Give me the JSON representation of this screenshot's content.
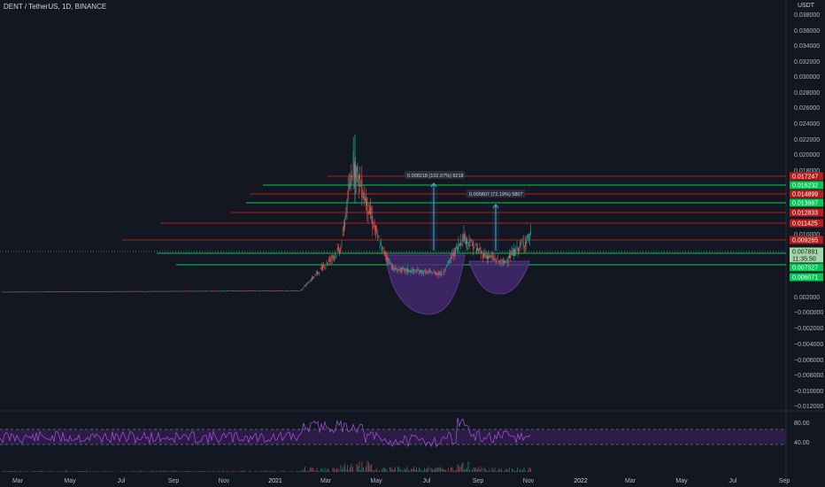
{
  "header": {
    "symbol": "DENT / TetherUS, 1D, BINANCE",
    "currency": "USDT"
  },
  "chart_data": {
    "type": "candlestick",
    "price_axis": {
      "ticks": [
        "0.038000",
        "0.036000",
        "0.034000",
        "0.032000",
        "0.030000",
        "0.028000",
        "0.026000",
        "0.024000",
        "0.022000",
        "0.020000",
        "0.018000",
        "0.010000",
        "0.002000",
        "−0.000000",
        "−0.002000",
        "−0.004000",
        "−0.006000",
        "−0.008000",
        "−0.010000",
        "−0.012000"
      ]
    },
    "time_axis": {
      "labels": [
        "Mar",
        "May",
        "Jul",
        "Sep",
        "Nov",
        "2021",
        "Mar",
        "May",
        "Jul",
        "Sep",
        "Nov",
        "2022",
        "Mar",
        "May",
        "Jul",
        "Sep"
      ]
    },
    "price_badges": [
      {
        "value": "0.017247",
        "color": "#b71c1c"
      },
      {
        "value": "0.016232",
        "color": "#00c853"
      },
      {
        "value": "0.014899",
        "color": "#b71c1c"
      },
      {
        "value": "0.013887",
        "color": "#00c853"
      },
      {
        "value": "0.012833",
        "color": "#b71c1c"
      },
      {
        "value": "0.011425",
        "color": "#b71c1c"
      },
      {
        "value": "0.009265",
        "color": "#b71c1c"
      },
      {
        "value": "0.007891",
        "color": "#a5d6a7"
      },
      {
        "value": "11:35:50",
        "color": "#a5d6a7"
      },
      {
        "value": "0.007527",
        "color": "#00c853"
      },
      {
        "value": "0.006071",
        "color": "#00c853"
      }
    ],
    "measure_labels": [
      {
        "text": "0.008218 (102.07%) 8218"
      },
      {
        "text": "0.005807 (72.19%) 5807"
      }
    ],
    "rsi_axis": {
      "ticks": [
        "80.00",
        "40.00"
      ]
    },
    "colors": {
      "up": "#26a69a",
      "down": "#ef5350",
      "support": "#00c853",
      "resistance": "#b71c1c",
      "rsi": "#9c4dcc",
      "cup": "#4a2a78"
    }
  }
}
